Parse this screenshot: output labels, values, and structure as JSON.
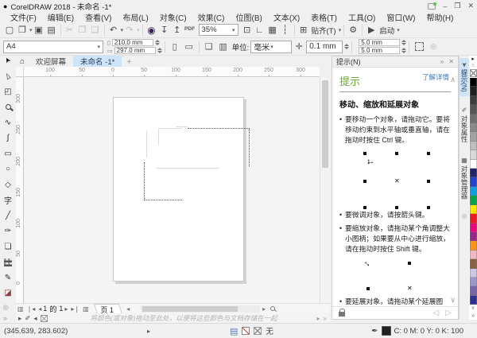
{
  "titlebar": {
    "title": "CorelDRAW 2018 - 未命名 -1*"
  },
  "menubar": {
    "items": [
      "文件(F)",
      "编辑(E)",
      "查看(V)",
      "布局(L)",
      "对象(C)",
      "效果(C)",
      "位图(B)",
      "文本(X)",
      "表格(T)",
      "工具(O)",
      "窗口(W)",
      "帮助(H)"
    ]
  },
  "toolbar": {
    "zoom_level": "35%",
    "snap_label": "贴齐(T)",
    "launch_label": "启动",
    "pdf_label": "PDF"
  },
  "property_bar": {
    "preset": "A4",
    "width": "210.0 mm",
    "height": "297.0 mm",
    "units_label": "单位:",
    "units_value": "毫米",
    "nudge_offset": "0.1 mm",
    "duplicate_x": "5.0 mm",
    "duplicate_y": "5.0 mm"
  },
  "doc_tabs": {
    "welcome": "欢迎屏幕",
    "active": "未命名 -1*",
    "new_tab": "+"
  },
  "rulers": {
    "horizontal": [
      "100",
      "50",
      "0",
      "50",
      "100",
      "150",
      "200",
      "250",
      "300"
    ],
    "vertical": [
      "300",
      "250",
      "200",
      "150",
      "100",
      "50",
      "0"
    ]
  },
  "hints_panel": {
    "docker_title": "提示(N)",
    "title": "提示",
    "learn_more": "了解详情",
    "section_heading": "移动、缩放和延展对象",
    "bullet_move": "要移动一个对象，请拖动它。要将移动约束到水平轴或垂直轴，请在拖动时按住 Ctrl 键。",
    "bullet_nudge": "要微调对象，请按箭头键。",
    "bullet_scale": "要缩放对象，请拖动某个角调整大小图柄；如果要从中心进行缩放，请在拖动时按住 Shift 键。",
    "bullet_stretch": "要延展对象，请拖动某个延展图柄；如果要从中心进行延展，请在拖动时按住 Shift"
  },
  "docker_tabs": {
    "tips": "提示(N)",
    "object_properties": "对象属性",
    "object_manager": "对象管理器"
  },
  "palette": {
    "colors": [
      "#000000",
      "#202020",
      "#3b3b3b",
      "#555555",
      "#6f6f6f",
      "#898989",
      "#a3a3a3",
      "#bdbdbd",
      "#d7d7d7",
      "#ffffff",
      "#20246a",
      "#2144c7",
      "#0f9ee0",
      "#0ba04a",
      "#ffe600",
      "#ed1c24",
      "#e5087e",
      "#93278f",
      "#f7941d",
      "#f4b8c5",
      "#8a6240",
      "#cdc6e4",
      "#9e97cf",
      "#7864ab",
      "#2e3192"
    ]
  },
  "page_bar": {
    "current_page": "1",
    "of_label": "的",
    "total_pages": "1",
    "page_tab": "页 1"
  },
  "color_well_row": {
    "hint": "将颜色(或对象)拖动至此处，以便将这些颜色与文档存储在一起"
  },
  "status_bar": {
    "coordinates": "(345.639, 283.602)",
    "fill_label": "无",
    "outline_value": "C: 0 M: 0 Y: 0 K: 100",
    "outline_color": "#231f20"
  },
  "icons": {
    "app_logo": "●",
    "minimize": "–",
    "restore": "❐",
    "close": "✕",
    "new": "▢",
    "open": "❐",
    "save": "▣",
    "print": "▤",
    "cut": "✂",
    "copy": "❐",
    "paste": "❑",
    "undo": "↶",
    "redo": "↷",
    "content": "◉",
    "import": "↧",
    "export": "↥",
    "fit": "⊡",
    "ruler_toggle": "∟",
    "grid_toggle": "▦",
    "guides_toggle": "┆",
    "snap": "⊞",
    "gear": "⚙",
    "launch": "▶",
    "dropdown": "▾",
    "portrait": "▯",
    "landscape": "▭",
    "pages_all": "❏",
    "pages_current": "▥",
    "nudge": "✛",
    "plus": "⊕",
    "home": "⌂",
    "pick": "➤",
    "shape": "▻",
    "crop": "◰",
    "freehand": "∿",
    "media": "∫",
    "rectangle": "▭",
    "ellipse": "○",
    "polygon": "◇",
    "text": "字",
    "dimension": "╱",
    "pen": "✑",
    "contour": "❏",
    "eyedropper": "✎",
    "fill": "◪",
    "chevron_up": "∧",
    "chevron_down": "∨",
    "expand": "»",
    "nav_first": "❘◂",
    "nav_prev": "◂",
    "nav_next": "▸",
    "nav_last": "▸❘",
    "page_icon": "▥",
    "back": "◁",
    "forward": "▷",
    "arrow_h": "↔",
    "arrow_v": "↕",
    "cross": "✕",
    "small_arrow": "▸",
    "collapse_left": "◂",
    "status_pen": "✒",
    "well_eyedropper": "✐"
  }
}
